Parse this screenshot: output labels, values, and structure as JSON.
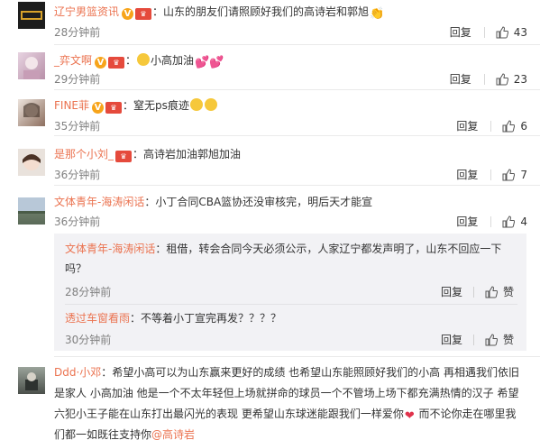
{
  "colors": {
    "username": "#eb7350",
    "meta": "#808080",
    "text": "#333333",
    "subbox": "#f2f2f5"
  },
  "comments": [
    {
      "user": "辽宁男篮资讯",
      "sep": "：",
      "text": "山东的朋友们请照顾好我们的高诗岩和郭旭",
      "time": "28分钟前",
      "reply": "回复",
      "likes": "43",
      "icons": [
        "v-badge-icon",
        "member-badge-icon",
        "clap-emoji-icon"
      ]
    },
    {
      "user": "_弈文啊",
      "sep": "：",
      "text": "小高加油",
      "time": "29分钟前",
      "reply": "回复",
      "likes": "23",
      "icons": [
        "v-badge-icon",
        "member-badge-icon",
        "sad-emoji-icon",
        "heart-emoji-icon"
      ]
    },
    {
      "user": "FINE菲",
      "sep": "：",
      "text": "窒无ps痕迹",
      "time": "35分钟前",
      "reply": "回复",
      "likes": "6",
      "icons": [
        "v-badge-icon",
        "member-badge-icon",
        "grin-emoji-icon"
      ]
    },
    {
      "user": "是那个小刘_",
      "sep": "：",
      "text": "高诗岩加油郭旭加油",
      "time": "36分钟前",
      "reply": "回复",
      "likes": "7",
      "icons": [
        "member-badge-icon"
      ]
    },
    {
      "user": "文体青年-海涛闲话",
      "sep": "：",
      "text": "小丁合同CBA篮协还没审核完，明后天才能宣",
      "time": "36分钟前",
      "reply": "回复",
      "likes": "4",
      "icons": []
    }
  ],
  "sub_replies": [
    {
      "user": "文体青年-海涛闲话",
      "sep": "：",
      "line1": "租借，转会合同今天必须公示，人家辽宁都发声明了，山东不回应一下",
      "line2": "吗？",
      "time": "28分钟前",
      "reply": "回复",
      "like": "赞"
    },
    {
      "user": "透过车窗看雨",
      "sep": "：",
      "text": "不等着小丁宣完再发？？？？",
      "time": "30分钟前",
      "reply": "回复",
      "like": "赞"
    }
  ],
  "last_comment": {
    "user": "Ddd·小邓",
    "sep": "：",
    "line1": "希望小高可以为山东赢来更好的成绩 也希望山东能照顾好我们的小高 再相遇我们依旧",
    "line2": "是家人 小高加油 他是一个不太年轻但上场就拼命的球员一个不管场上场下都充满热情的汉子 希望",
    "line3a": "六犯小王子能在山东打出最闪光的表现 更希望山东球迷能跟我们一样爱你",
    "line3b": " 而不论你走在哪里我",
    "line4": "们都一如既往支持你",
    "mention": "@高诗岩_"
  }
}
